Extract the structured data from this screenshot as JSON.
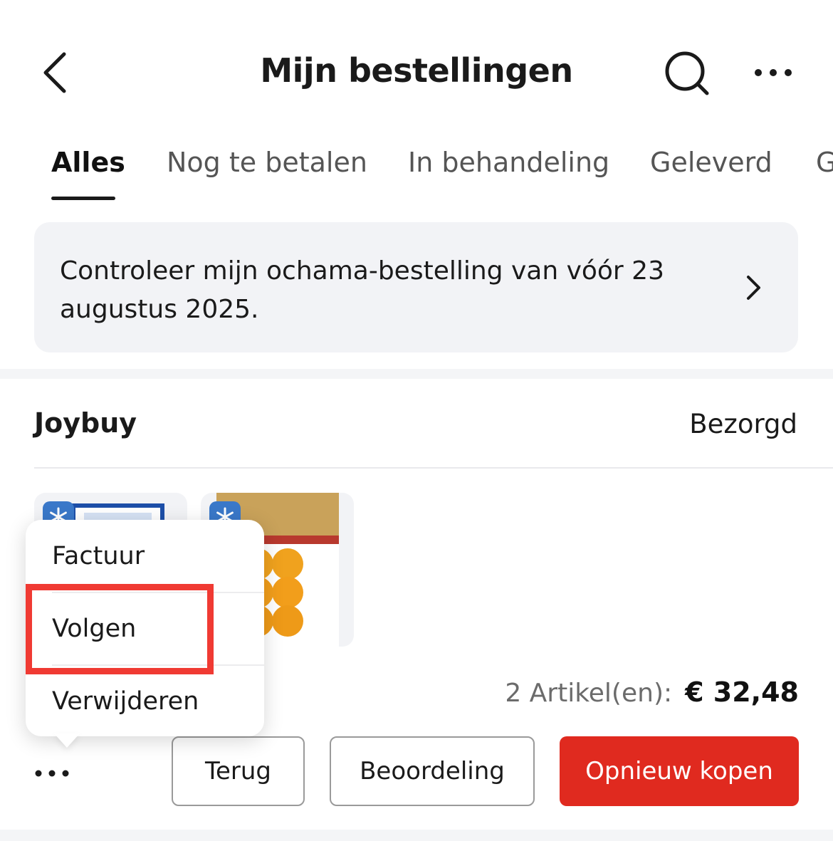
{
  "header": {
    "title": "Mijn bestellingen",
    "back_icon": "chevron-left-icon",
    "search_icon": "search-icon",
    "more_icon": "ellipsis-icon"
  },
  "tabs": [
    {
      "label": "Alles",
      "active": true
    },
    {
      "label": "Nog te betalen",
      "active": false
    },
    {
      "label": "In behandeling",
      "active": false
    },
    {
      "label": "Geleverd",
      "active": false
    },
    {
      "label": "G",
      "active": false
    }
  ],
  "notice": {
    "text": "Controleer mijn ochama-bestelling van vóór 23 augustus 2025."
  },
  "order": {
    "store": "Joybuy",
    "status": "Bezorgd",
    "item_count": "2 Artikel(en):",
    "total": "€ 32,48",
    "products": [
      {
        "name": "product-frozen-1",
        "badge_icon": "snowflake-icon"
      },
      {
        "name": "product-salted-egg",
        "badge_icon": "snowflake-icon"
      }
    ],
    "buttons": {
      "return": "Terug",
      "review": "Beoordeling",
      "rebuy": "Opnieuw kopen"
    }
  },
  "menu": {
    "items": [
      "Factuur",
      "Volgen",
      "Verwijderen"
    ],
    "highlighted": "Volgen"
  },
  "colors": {
    "accent_red": "#e02a1f",
    "highlight_red": "#f03a33",
    "notice_bg": "#f2f3f6"
  }
}
